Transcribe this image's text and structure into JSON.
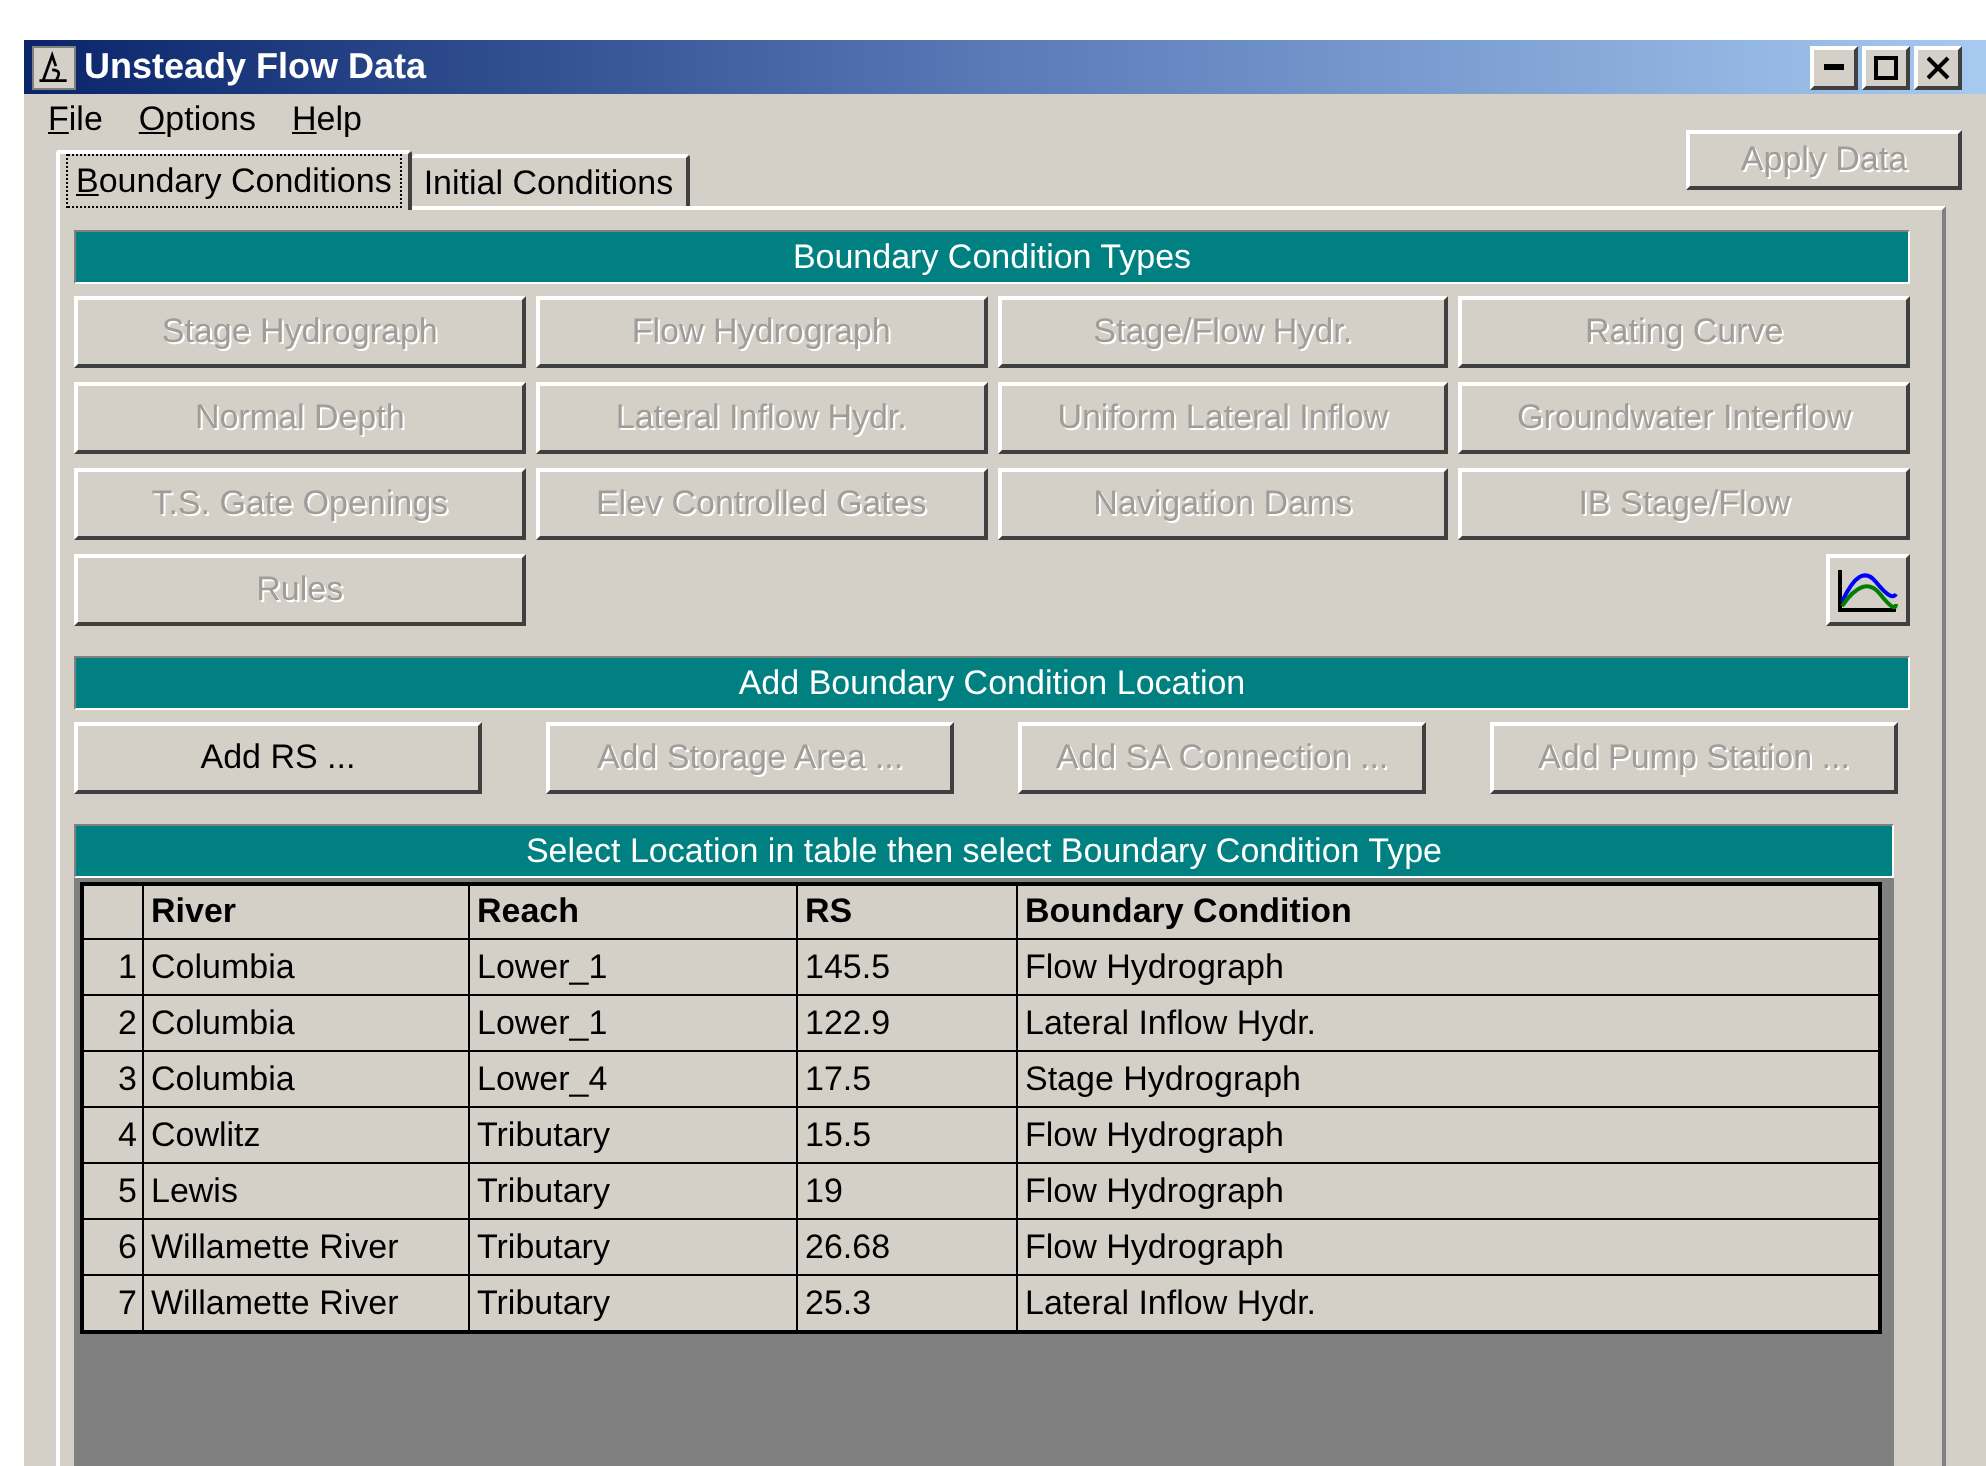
{
  "window": {
    "title": "Unsteady Flow Data"
  },
  "menu": [
    {
      "label": "File"
    },
    {
      "label": "Options"
    },
    {
      "label": "Help"
    }
  ],
  "tabs": [
    {
      "label": "Boundary Conditions",
      "selected": true
    },
    {
      "label": "Initial Conditions",
      "selected": false
    }
  ],
  "apply_button": {
    "label": "Apply Data",
    "disabled": true
  },
  "types_header": "Boundary Condition Types",
  "type_buttons": [
    {
      "label": "Stage Hydrograph",
      "disabled": true
    },
    {
      "label": "Flow Hydrograph",
      "disabled": true
    },
    {
      "label": "Stage/Flow Hydr.",
      "disabled": true
    },
    {
      "label": "Rating Curve",
      "disabled": true
    },
    {
      "label": "Normal Depth",
      "disabled": true
    },
    {
      "label": "Lateral Inflow Hydr.",
      "disabled": true
    },
    {
      "label": "Uniform Lateral Inflow",
      "disabled": true
    },
    {
      "label": "Groundwater Interflow",
      "disabled": true
    },
    {
      "label": "T.S. Gate Openings",
      "disabled": true
    },
    {
      "label": "Elev Controlled Gates",
      "disabled": true
    },
    {
      "label": "Navigation Dams",
      "disabled": true
    },
    {
      "label": "IB Stage/Flow",
      "disabled": true
    },
    {
      "label": "Rules",
      "disabled": true
    }
  ],
  "location_header": "Add Boundary Condition Location",
  "location_buttons": [
    {
      "label": "Add RS ...",
      "disabled": false
    },
    {
      "label": "Add Storage Area ...",
      "disabled": true
    },
    {
      "label": "Add SA Connection ...",
      "disabled": true
    },
    {
      "label": "Add Pump Station ...",
      "disabled": true
    }
  ],
  "table_header": "Select Location in table then select Boundary Condition Type",
  "table": {
    "columns": [
      "",
      "River",
      "Reach",
      "RS",
      "Boundary Condition"
    ],
    "rows": [
      [
        "1",
        "Columbia",
        "Lower_1",
        "145.5",
        "Flow Hydrograph"
      ],
      [
        "2",
        "Columbia",
        "Lower_1",
        "122.9",
        "Lateral Inflow Hydr."
      ],
      [
        "3",
        "Columbia",
        "Lower_4",
        "17.5",
        "Stage Hydrograph"
      ],
      [
        "4",
        "Cowlitz",
        "Tributary",
        "15.5",
        "Flow Hydrograph"
      ],
      [
        "5",
        "Lewis",
        "Tributary",
        "19",
        "Flow Hydrograph"
      ],
      [
        "6",
        "Willamette River",
        "Tributary",
        "26.68",
        "Flow Hydrograph"
      ],
      [
        "7",
        "Willamette River",
        "Tributary",
        "25.3",
        "Lateral Inflow Hydr."
      ]
    ]
  }
}
